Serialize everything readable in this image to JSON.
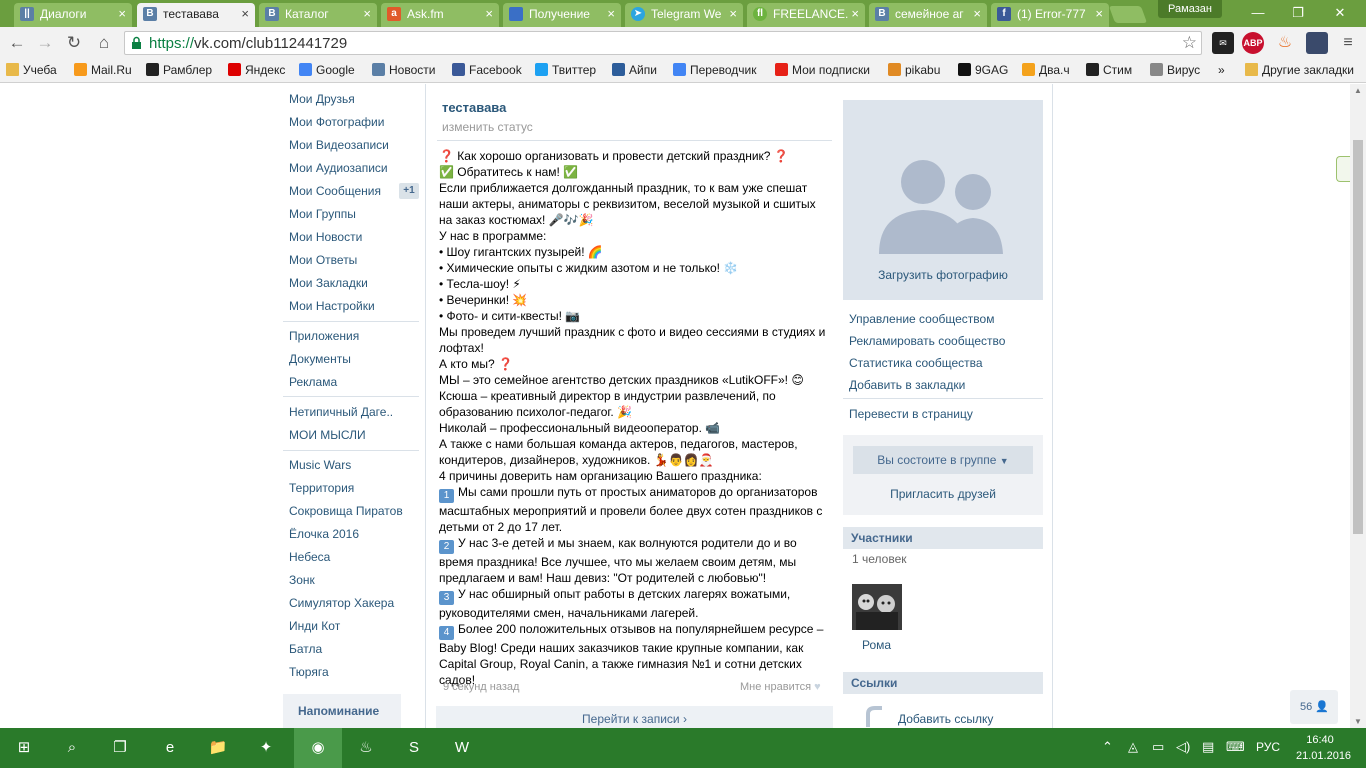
{
  "browser": {
    "tabs": [
      {
        "title": "Диалоги",
        "icon": "VK",
        "icon_color": "#5b7fa6",
        "active": false
      },
      {
        "title": "теставава",
        "icon": "В",
        "icon_color": "#5b7fa6",
        "active": true
      },
      {
        "title": "Каталог",
        "icon": "В",
        "icon_color": "#5b7fa6",
        "active": false
      },
      {
        "title": "Ask.fm",
        "icon": "a",
        "icon_color": "#e05a2a",
        "active": false
      },
      {
        "title": "Получение",
        "icon": "RU",
        "icon_color": "#3a6fc6",
        "active": false
      },
      {
        "title": "Telegram We",
        "icon": "T",
        "icon_color": "#2ca5e0",
        "active": false
      },
      {
        "title": "FREELANCE.",
        "icon": "fl",
        "icon_color": "#6db33f",
        "active": false
      },
      {
        "title": "семейное аг",
        "icon": "В",
        "icon_color": "#5b7fa6",
        "active": false
      },
      {
        "title": "(1) Error-777",
        "icon": "f",
        "icon_color": "#3b5998",
        "active": false
      }
    ],
    "profile_name": "Рамазан",
    "url_scheme": "https://",
    "url_rest": "vk.com/club112441729",
    "extensions": [
      {
        "name": "notifier-icon",
        "label": "2",
        "color": "#222"
      },
      {
        "name": "adblock-icon",
        "label": "ABP",
        "color": "#c8102e"
      },
      {
        "name": "flame-icon",
        "label": "",
        "color": "#e96a1d"
      },
      {
        "name": "app-icon",
        "label": "",
        "color": "#3a4a6b"
      },
      {
        "name": "menu-icon",
        "label": "≡",
        "color": "#666"
      }
    ],
    "bookmarks": [
      {
        "label": "Учеба",
        "icon": "folder",
        "color": "#e8b94a"
      },
      {
        "label": "Mail.Ru",
        "icon": "@",
        "color": "#f79a1c"
      },
      {
        "label": "Рамблер",
        "icon": "R",
        "color": "#222"
      },
      {
        "label": "Яндекс",
        "icon": "Я",
        "color": "#d00"
      },
      {
        "label": "Google",
        "icon": "G",
        "color": "#4285f4"
      },
      {
        "label": "Новости",
        "icon": "В",
        "color": "#5b7fa6"
      },
      {
        "label": "Facebook",
        "icon": "f",
        "color": "#3b5998"
      },
      {
        "label": "Твиттер",
        "icon": "t",
        "color": "#1da1f2"
      },
      {
        "label": "Айпи",
        "icon": "IP",
        "color": "#2d5d9a"
      },
      {
        "label": "Переводчик",
        "icon": "G",
        "color": "#4285f4"
      },
      {
        "label": "Мои подписки",
        "icon": "▶",
        "color": "#e62117"
      },
      {
        "label": "pikabu",
        "icon": "p",
        "color": "#e08a24"
      },
      {
        "label": "9GAG",
        "icon": "9",
        "color": "#111"
      },
      {
        "label": "Два.ч",
        "icon": "⚡",
        "color": "#f4a21c"
      },
      {
        "label": "Стим",
        "icon": "S",
        "color": "#222"
      },
      {
        "label": "Вирус",
        "icon": "□",
        "color": "#888"
      },
      {
        "label": "»",
        "icon": "",
        "color": ""
      },
      {
        "label": "Другие закладки",
        "icon": "folder",
        "color": "#e8b94a"
      }
    ]
  },
  "left_menu": {
    "main": [
      "Мои Друзья",
      "Мои Фотографии",
      "Мои Видеозаписи",
      "Мои Аудиозаписи",
      "Мои Сообщения",
      "Мои Группы",
      "Мои Новости",
      "Мои Ответы",
      "Мои Закладки",
      "Мои Настройки"
    ],
    "messages_badge": "+1",
    "extra": [
      "Приложения",
      "Документы",
      "Реклама"
    ],
    "pages": [
      "Нетипичный Даге..",
      "МОИ МЫСЛИ"
    ],
    "apps": [
      "Music Wars",
      "Территория",
      "Сокровища Пиратов",
      "Ёлочка 2016",
      "Небеса",
      "Зонк",
      "Симулятор Хакера",
      "Инди Кот",
      "Батла",
      "Тюряга"
    ],
    "reminder": "Напоминание"
  },
  "group": {
    "title": "теставава",
    "status_link": "изменить статус",
    "description": [
      {
        "pre": "❓",
        "text": " Как хорошо организовать и провести детский праздник? ",
        "post": "❓"
      },
      {
        "pre": "✅",
        "text": " Обратитесь к нам! ",
        "post": "✅"
      },
      {
        "text": "Если приближается долгожданный праздник, то к вам уже спешат наши актеры, аниматоры с реквизитом, веселой музыкой и сшитых на заказ костюмах! 🎤🎶🎉"
      },
      {
        "text": "У нас в программе:"
      },
      {
        "text": "• Шоу гигантских пузырей! 🌈"
      },
      {
        "text": "• Химические опыты с жидким азотом и не только! ❄️"
      },
      {
        "text": "• Тесла-шоу! ⚡"
      },
      {
        "text": "• Вечеринки! 💥"
      },
      {
        "text": "• Фото- и сити-квесты! 📷"
      },
      {
        "text": "Мы проведем лучший праздник с фото и видео сессиями в студиях и лофтах!"
      },
      {
        "text": "А кто мы? ❓"
      },
      {
        "text": "МЫ – это семейное агентство детских праздников «LutikOFF»! 😊"
      },
      {
        "text": "Ксюша – креативный директор в индустрии развлечений, по образованию психолог-педагог. 🎉"
      },
      {
        "text": "Николай – профессиональный видеооператор. 📹"
      },
      {
        "text": "А также с нами большая команда актеров, педагогов, мастеров, кондитеров, дизайнеров, художников. 💃👨👩🎅"
      },
      {
        "text": "4 причины доверить нам организацию Вашего праздника:"
      },
      {
        "num": "1",
        "text": "Мы сами прошли путь от простых аниматоров до организаторов масштабных мероприятий и провели более двух сотен праздников с детьми от 2 до 17 лет."
      },
      {
        "num": "2",
        "text": "У нас 3-е детей и мы знаем, как волнуются родители до и во время праздника! Все лучшее, что мы желаем своим детям, мы предлагаем и вам! Наш девиз: \"От родителей с любовью\"!"
      },
      {
        "num": "3",
        "text": "У нас обширный опыт работы в детских лагерях вожатыми, руководителями смен, начальниками лагерей."
      },
      {
        "num": "4",
        "text": "Более 200 положительных отзывов на популярнейшем ресурсе – Baby Blog! Среди наших заказчиков такие крупные компании, как Capital Group, Royal Canin, а также гимназия №1 и сотни детских садов!"
      }
    ],
    "post_time": "9 секунд назад",
    "like_label": "Мне нравится",
    "goto_label": "Перейти к записи"
  },
  "sidebar": {
    "upload_photo": "Загрузить фотографию",
    "admin_links": [
      "Управление сообществом",
      "Рекламировать сообщество",
      "Статистика сообщества",
      "Добавить в закладки"
    ],
    "convert_link": "Перевести в страницу",
    "member_button": "Вы состоите в группе",
    "invite": "Пригласить друзей",
    "members_header": "Участники",
    "members_count": "1 человек",
    "member_name": "Рома",
    "links_header": "Ссылки",
    "add_link": "Добавить ссылку",
    "online_count": "56"
  },
  "taskbar": {
    "apps": [
      {
        "name": "start-icon",
        "glyph": "⊞"
      },
      {
        "name": "search-icon",
        "glyph": "⌕"
      },
      {
        "name": "task-view-icon",
        "glyph": "❐"
      },
      {
        "name": "edge-icon",
        "glyph": "e"
      },
      {
        "name": "explorer-icon",
        "glyph": "📁"
      },
      {
        "name": "app-icon",
        "glyph": "✦"
      },
      {
        "name": "chrome-icon",
        "glyph": "◉"
      },
      {
        "name": "steam-icon",
        "glyph": "♨"
      },
      {
        "name": "skype-icon",
        "glyph": "S"
      },
      {
        "name": "word-icon",
        "glyph": "W"
      }
    ],
    "language": "РУС",
    "time": "16:40",
    "date": "21.01.2016"
  }
}
